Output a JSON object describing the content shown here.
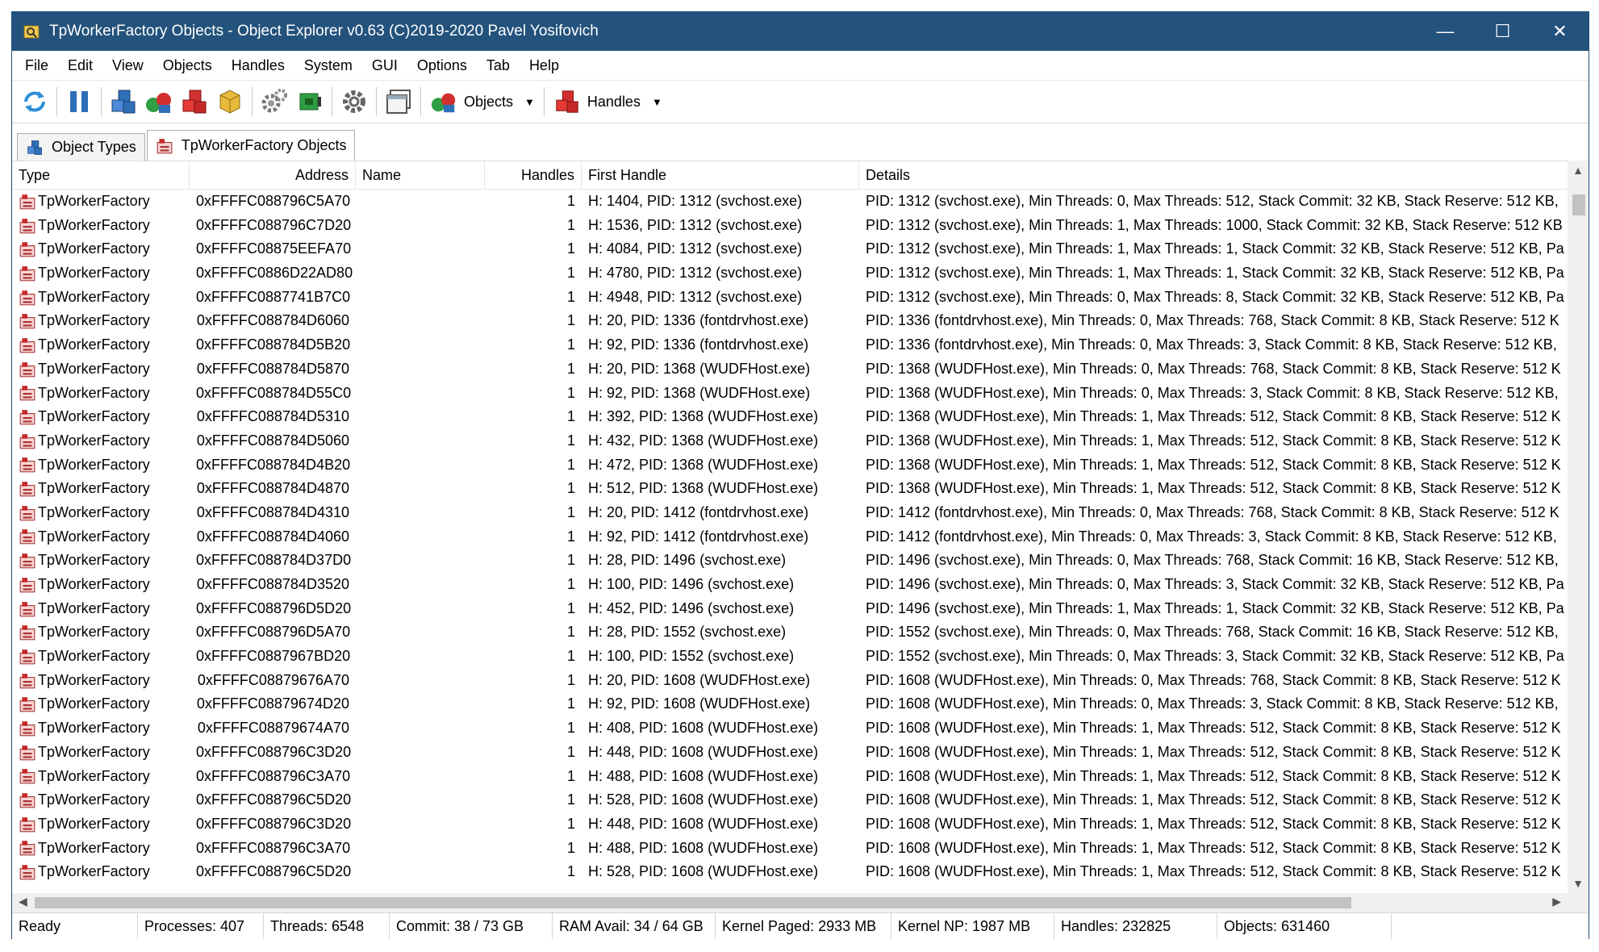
{
  "window": {
    "title": "TpWorkerFactory Objects - Object Explorer v0.63 (C)2019-2020 Pavel Yosifovich",
    "controls": {
      "minimize": "—",
      "maximize": "☐",
      "close": "✕"
    }
  },
  "menu": [
    "File",
    "Edit",
    "View",
    "Objects",
    "Handles",
    "System",
    "GUI",
    "Options",
    "Tab",
    "Help"
  ],
  "toolbar": {
    "objects_label": "Objects",
    "handles_label": "Handles"
  },
  "tabs": [
    {
      "label": "Object Types",
      "icon": "object-types-icon",
      "active": false
    },
    {
      "label": "TpWorkerFactory Objects",
      "icon": "worker-factory-icon",
      "active": true
    }
  ],
  "columns": {
    "type": "Type",
    "address": "Address",
    "name": "Name",
    "handles": "Handles",
    "first_handle": "First Handle",
    "details": "Details"
  },
  "rows": [
    {
      "type": "TpWorkerFactory",
      "address": "0xFFFFC088796C5A70",
      "name": "",
      "handles": "1",
      "first_handle": "H: 1404, PID: 1312 (svchost.exe)",
      "details": "PID: 1312 (svchost.exe), Min Threads: 0, Max Threads: 512, Stack Commit: 32 KB, Stack Reserve: 512 KB,"
    },
    {
      "type": "TpWorkerFactory",
      "address": "0xFFFFC088796C7D20",
      "name": "",
      "handles": "1",
      "first_handle": "H: 1536, PID: 1312 (svchost.exe)",
      "details": "PID: 1312 (svchost.exe), Min Threads: 1, Max Threads: 1000, Stack Commit: 32 KB, Stack Reserve: 512 KB"
    },
    {
      "type": "TpWorkerFactory",
      "address": "0xFFFFC08875EEFA70",
      "name": "",
      "handles": "1",
      "first_handle": "H: 4084, PID: 1312 (svchost.exe)",
      "details": "PID: 1312 (svchost.exe), Min Threads: 1, Max Threads: 1, Stack Commit: 32 KB, Stack Reserve: 512 KB, Pa"
    },
    {
      "type": "TpWorkerFactory",
      "address": "0xFFFFC0886D22AD80",
      "name": "",
      "handles": "1",
      "first_handle": "H: 4780, PID: 1312 (svchost.exe)",
      "details": "PID: 1312 (svchost.exe), Min Threads: 1, Max Threads: 1, Stack Commit: 32 KB, Stack Reserve: 512 KB, Pa"
    },
    {
      "type": "TpWorkerFactory",
      "address": "0xFFFFC0887741B7C0",
      "name": "",
      "handles": "1",
      "first_handle": "H: 4948, PID: 1312 (svchost.exe)",
      "details": "PID: 1312 (svchost.exe), Min Threads: 0, Max Threads: 8, Stack Commit: 32 KB, Stack Reserve: 512 KB, Pa"
    },
    {
      "type": "TpWorkerFactory",
      "address": "0xFFFFC088784D6060",
      "name": "",
      "handles": "1",
      "first_handle": "H: 20, PID: 1336 (fontdrvhost.exe)",
      "details": "PID: 1336 (fontdrvhost.exe), Min Threads: 0, Max Threads: 768, Stack Commit: 8 KB, Stack Reserve: 512 K"
    },
    {
      "type": "TpWorkerFactory",
      "address": "0xFFFFC088784D5B20",
      "name": "",
      "handles": "1",
      "first_handle": "H: 92, PID: 1336 (fontdrvhost.exe)",
      "details": "PID: 1336 (fontdrvhost.exe), Min Threads: 0, Max Threads: 3, Stack Commit: 8 KB, Stack Reserve: 512 KB,"
    },
    {
      "type": "TpWorkerFactory",
      "address": "0xFFFFC088784D5870",
      "name": "",
      "handles": "1",
      "first_handle": "H: 20, PID: 1368 (WUDFHost.exe)",
      "details": "PID: 1368 (WUDFHost.exe), Min Threads: 0, Max Threads: 768, Stack Commit: 8 KB, Stack Reserve: 512 K"
    },
    {
      "type": "TpWorkerFactory",
      "address": "0xFFFFC088784D55C0",
      "name": "",
      "handles": "1",
      "first_handle": "H: 92, PID: 1368 (WUDFHost.exe)",
      "details": "PID: 1368 (WUDFHost.exe), Min Threads: 0, Max Threads: 3, Stack Commit: 8 KB, Stack Reserve: 512 KB,"
    },
    {
      "type": "TpWorkerFactory",
      "address": "0xFFFFC088784D5310",
      "name": "",
      "handles": "1",
      "first_handle": "H: 392, PID: 1368 (WUDFHost.exe)",
      "details": "PID: 1368 (WUDFHost.exe), Min Threads: 1, Max Threads: 512, Stack Commit: 8 KB, Stack Reserve: 512 K"
    },
    {
      "type": "TpWorkerFactory",
      "address": "0xFFFFC088784D5060",
      "name": "",
      "handles": "1",
      "first_handle": "H: 432, PID: 1368 (WUDFHost.exe)",
      "details": "PID: 1368 (WUDFHost.exe), Min Threads: 1, Max Threads: 512, Stack Commit: 8 KB, Stack Reserve: 512 K"
    },
    {
      "type": "TpWorkerFactory",
      "address": "0xFFFFC088784D4B20",
      "name": "",
      "handles": "1",
      "first_handle": "H: 472, PID: 1368 (WUDFHost.exe)",
      "details": "PID: 1368 (WUDFHost.exe), Min Threads: 1, Max Threads: 512, Stack Commit: 8 KB, Stack Reserve: 512 K"
    },
    {
      "type": "TpWorkerFactory",
      "address": "0xFFFFC088784D4870",
      "name": "",
      "handles": "1",
      "first_handle": "H: 512, PID: 1368 (WUDFHost.exe)",
      "details": "PID: 1368 (WUDFHost.exe), Min Threads: 1, Max Threads: 512, Stack Commit: 8 KB, Stack Reserve: 512 K"
    },
    {
      "type": "TpWorkerFactory",
      "address": "0xFFFFC088784D4310",
      "name": "",
      "handles": "1",
      "first_handle": "H: 20, PID: 1412 (fontdrvhost.exe)",
      "details": "PID: 1412 (fontdrvhost.exe), Min Threads: 0, Max Threads: 768, Stack Commit: 8 KB, Stack Reserve: 512 K"
    },
    {
      "type": "TpWorkerFactory",
      "address": "0xFFFFC088784D4060",
      "name": "",
      "handles": "1",
      "first_handle": "H: 92, PID: 1412 (fontdrvhost.exe)",
      "details": "PID: 1412 (fontdrvhost.exe), Min Threads: 0, Max Threads: 3, Stack Commit: 8 KB, Stack Reserve: 512 KB,"
    },
    {
      "type": "TpWorkerFactory",
      "address": "0xFFFFC088784D37D0",
      "name": "",
      "handles": "1",
      "first_handle": "H: 28, PID: 1496 (svchost.exe)",
      "details": "PID: 1496 (svchost.exe), Min Threads: 0, Max Threads: 768, Stack Commit: 16 KB, Stack Reserve: 512 KB,"
    },
    {
      "type": "TpWorkerFactory",
      "address": "0xFFFFC088784D3520",
      "name": "",
      "handles": "1",
      "first_handle": "H: 100, PID: 1496 (svchost.exe)",
      "details": "PID: 1496 (svchost.exe), Min Threads: 0, Max Threads: 3, Stack Commit: 32 KB, Stack Reserve: 512 KB, Pa"
    },
    {
      "type": "TpWorkerFactory",
      "address": "0xFFFFC088796D5D20",
      "name": "",
      "handles": "1",
      "first_handle": "H: 452, PID: 1496 (svchost.exe)",
      "details": "PID: 1496 (svchost.exe), Min Threads: 1, Max Threads: 1, Stack Commit: 32 KB, Stack Reserve: 512 KB, Pa"
    },
    {
      "type": "TpWorkerFactory",
      "address": "0xFFFFC088796D5A70",
      "name": "",
      "handles": "1",
      "first_handle": "H: 28, PID: 1552 (svchost.exe)",
      "details": "PID: 1552 (svchost.exe), Min Threads: 0, Max Threads: 768, Stack Commit: 16 KB, Stack Reserve: 512 KB,"
    },
    {
      "type": "TpWorkerFactory",
      "address": "0xFFFFC0887967BD20",
      "name": "",
      "handles": "1",
      "first_handle": "H: 100, PID: 1552 (svchost.exe)",
      "details": "PID: 1552 (svchost.exe), Min Threads: 0, Max Threads: 3, Stack Commit: 32 KB, Stack Reserve: 512 KB, Pa"
    },
    {
      "type": "TpWorkerFactory",
      "address": "0xFFFFC08879676A70",
      "name": "",
      "handles": "1",
      "first_handle": "H: 20, PID: 1608 (WUDFHost.exe)",
      "details": "PID: 1608 (WUDFHost.exe), Min Threads: 0, Max Threads: 768, Stack Commit: 8 KB, Stack Reserve: 512 K"
    },
    {
      "type": "TpWorkerFactory",
      "address": "0xFFFFC08879674D20",
      "name": "",
      "handles": "1",
      "first_handle": "H: 92, PID: 1608 (WUDFHost.exe)",
      "details": "PID: 1608 (WUDFHost.exe), Min Threads: 0, Max Threads: 3, Stack Commit: 8 KB, Stack Reserve: 512 KB,"
    },
    {
      "type": "TpWorkerFactory",
      "address": "0xFFFFC08879674A70",
      "name": "",
      "handles": "1",
      "first_handle": "H: 408, PID: 1608 (WUDFHost.exe)",
      "details": "PID: 1608 (WUDFHost.exe), Min Threads: 1, Max Threads: 512, Stack Commit: 8 KB, Stack Reserve: 512 K"
    },
    {
      "type": "TpWorkerFactory",
      "address": "0xFFFFC088796C3D20",
      "name": "",
      "handles": "1",
      "first_handle": "H: 448, PID: 1608 (WUDFHost.exe)",
      "details": "PID: 1608 (WUDFHost.exe), Min Threads: 1, Max Threads: 512, Stack Commit: 8 KB, Stack Reserve: 512 K"
    },
    {
      "type": "TpWorkerFactory",
      "address": "0xFFFFC088796C3A70",
      "name": "",
      "handles": "1",
      "first_handle": "H: 488, PID: 1608 (WUDFHost.exe)",
      "details": "PID: 1608 (WUDFHost.exe), Min Threads: 1, Max Threads: 512, Stack Commit: 8 KB, Stack Reserve: 512 K"
    },
    {
      "type": "TpWorkerFactory",
      "address": "0xFFFFC088796C5D20",
      "name": "",
      "handles": "1",
      "first_handle": "H: 528, PID: 1608 (WUDFHost.exe)",
      "details": "PID: 1608 (WUDFHost.exe), Min Threads: 1, Max Threads: 512, Stack Commit: 8 KB, Stack Reserve: 512 K"
    },
    {
      "type": "TpWorkerFactory",
      "address": "0xFFFFC088796C3D20",
      "name": "",
      "handles": "1",
      "first_handle": "H: 448, PID: 1608 (WUDFHost.exe)",
      "details": "PID: 1608 (WUDFHost.exe), Min Threads: 1, Max Threads: 512, Stack Commit: 8 KB, Stack Reserve: 512 K"
    },
    {
      "type": "TpWorkerFactory",
      "address": "0xFFFFC088796C3A70",
      "name": "",
      "handles": "1",
      "first_handle": "H: 488, PID: 1608 (WUDFHost.exe)",
      "details": "PID: 1608 (WUDFHost.exe), Min Threads: 1, Max Threads: 512, Stack Commit: 8 KB, Stack Reserve: 512 K"
    },
    {
      "type": "TpWorkerFactory",
      "address": "0xFFFFC088796C5D20",
      "name": "",
      "handles": "1",
      "first_handle": "H: 528, PID: 1608 (WUDFHost.exe)",
      "details": "PID: 1608 (WUDFHost.exe), Min Threads: 1, Max Threads: 512, Stack Commit: 8 KB, Stack Reserve: 512 K"
    }
  ],
  "status": {
    "ready": "Ready",
    "processes": "Processes: 407",
    "threads": "Threads: 6548",
    "commit": "Commit: 38 / 73 GB",
    "ram": "RAM Avail: 34 / 64 GB",
    "kernel_paged": "Kernel Paged: 2933 MB",
    "kernel_np": "Kernel NP: 1987 MB",
    "handles": "Handles: 232825",
    "objects": "Objects: 631460"
  },
  "colors": {
    "titlebar": "#23527c",
    "accent_red": "#d32f2f",
    "accent_blue": "#2f6fb8"
  }
}
